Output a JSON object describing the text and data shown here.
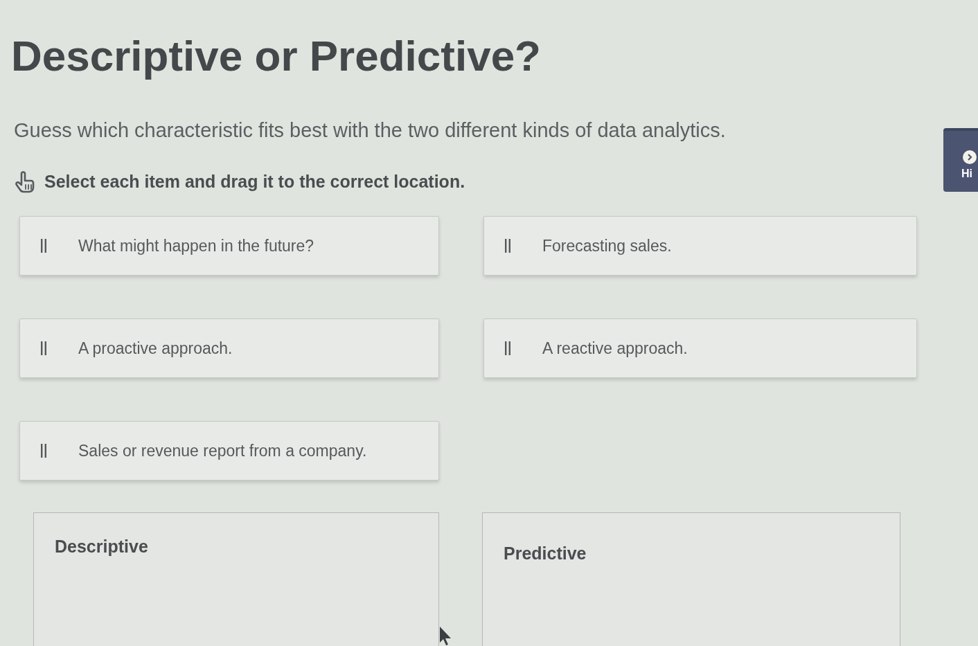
{
  "heading": "Descriptive or Predictive?",
  "intro": "Guess which characteristic fits best with the two different kinds of data analytics.",
  "instruction": "Select each item and drag it to the correct location.",
  "side_tab": {
    "label": "Hi"
  },
  "items": [
    {
      "label": "What might happen in the future?"
    },
    {
      "label": "Forecasting sales."
    },
    {
      "label": "A proactive approach."
    },
    {
      "label": "A reactive approach."
    },
    {
      "label": "Sales or revenue report from a company."
    }
  ],
  "drop_zones": [
    {
      "label": "Descriptive"
    },
    {
      "label": "Predictive"
    }
  ]
}
